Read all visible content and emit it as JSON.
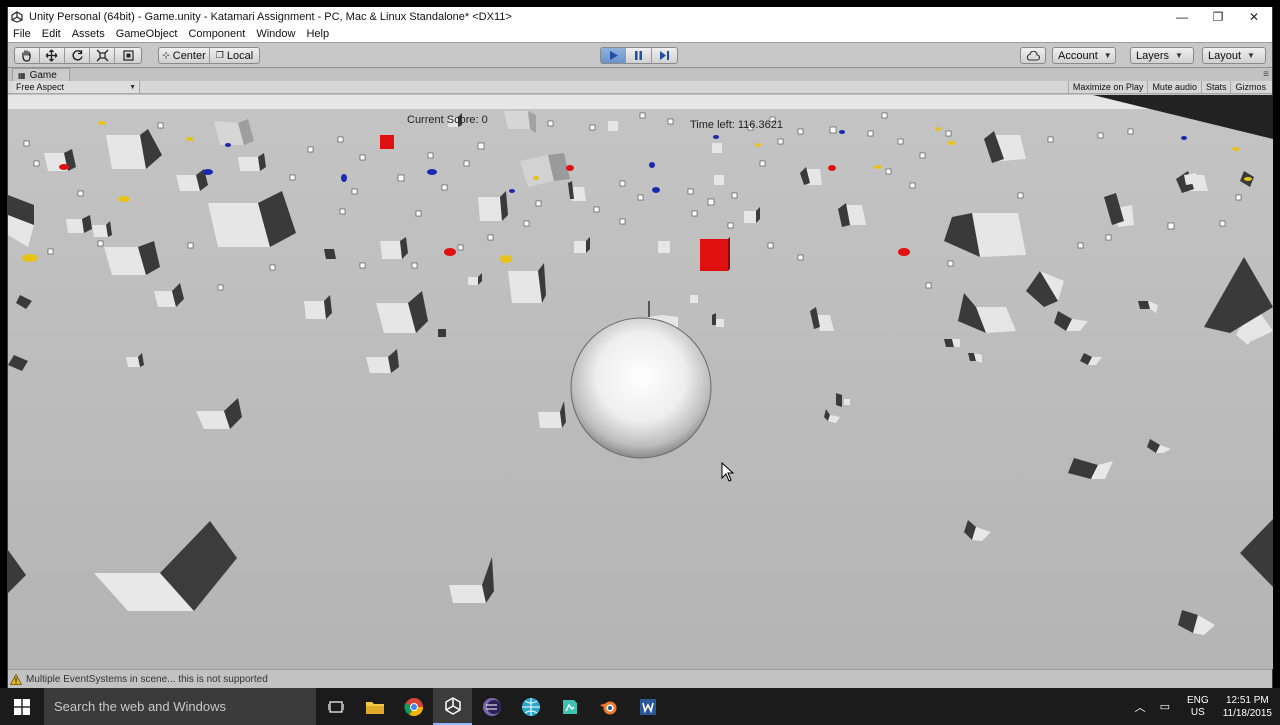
{
  "window": {
    "title": "Unity Personal (64bit) - Game.unity - Katamari Assignment - PC, Mac & Linux Standalone* <DX11>",
    "controls": {
      "minimize": "—",
      "maximize": "❐",
      "close": "✕"
    }
  },
  "menu": [
    "File",
    "Edit",
    "Assets",
    "GameObject",
    "Component",
    "Window",
    "Help"
  ],
  "toolbar": {
    "pivot": "Center",
    "space": "Local",
    "account": "Account",
    "layers": "Layers",
    "layout": "Layout"
  },
  "game_tab": {
    "label": "Game",
    "aspect": "Free Aspect",
    "toggles": [
      "Maximize on Play",
      "Mute audio",
      "Stats",
      "Gizmos"
    ]
  },
  "hud": {
    "score": "Current Score: 0",
    "time_left": "Time left: 116.3621"
  },
  "status": {
    "message": "Multiple EventSystems in scene... this is not supported"
  },
  "taskbar": {
    "search_placeholder": "Search the web and Windows",
    "icons": [
      "task-view",
      "file-explorer",
      "chrome",
      "unity",
      "eclipse",
      "globe",
      "app",
      "blender",
      "word"
    ],
    "lang_top": "ENG",
    "lang_bottom": "US",
    "time": "12:51 PM",
    "date": "11/18/2015"
  },
  "colors": {
    "ground": "#b7b7b7",
    "cube_light": "#e8e8e8",
    "cube_dark": "#3e3e3e",
    "red": "#e01010",
    "blue": "#1a2ab0",
    "yellow": "#e6c21a",
    "play_active": "#7a9fd3"
  }
}
